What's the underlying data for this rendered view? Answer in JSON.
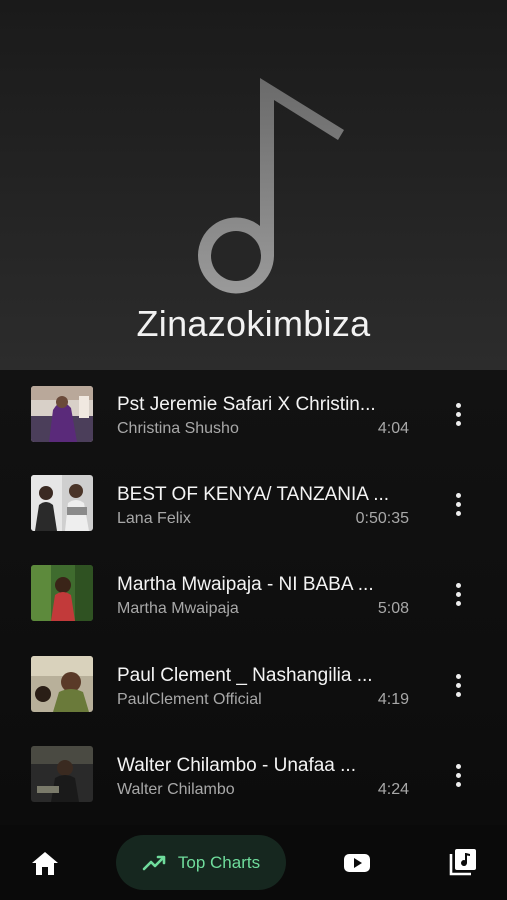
{
  "playlist": {
    "title": "Zinazokimbiza"
  },
  "songs": [
    {
      "title": "Pst Jeremie Safari X Christin...",
      "artist": "Christina Shusho",
      "duration": "4:04"
    },
    {
      "title": "BEST OF KENYA/ TANZANIA ...",
      "artist": "Lana Felix",
      "duration": "0:50:35"
    },
    {
      "title": "Martha Mwaipaja  - NI BABA ...",
      "artist": "Martha Mwaipaja",
      "duration": "5:08"
    },
    {
      "title": "Paul Clement _ Nashangilia ...",
      "artist": "PaulClement Official",
      "duration": "4:19"
    },
    {
      "title": "Walter Chilambo - Unafaa ...",
      "artist": "Walter Chilambo",
      "duration": "4:24"
    }
  ],
  "nav": {
    "home_icon": "home-icon",
    "charts_icon": "trending-up-icon",
    "charts_label": "Top Charts",
    "youtube_icon": "youtube-icon",
    "library_icon": "library-music-icon"
  },
  "colors": {
    "accent": "#6fdc9c",
    "accent_bg": "#16271f",
    "background": "#0a0a0a"
  }
}
